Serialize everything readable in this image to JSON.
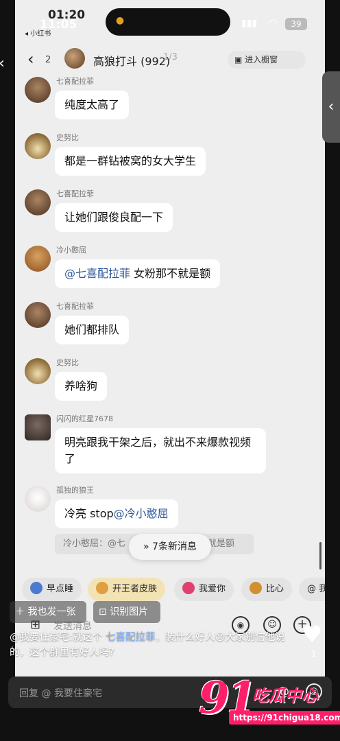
{
  "status": {
    "time_back": "01:20",
    "time_front": "11:05",
    "app_tag": "◂ 小红书",
    "battery": "39"
  },
  "chat": {
    "back_count": "2",
    "group_title": "高狼打斗 (992)",
    "counter": "1/3",
    "enter_label": "进入橱窗"
  },
  "messages": [
    {
      "sender": "七喜配拉菲",
      "text": "纯度太高了"
    },
    {
      "sender": "史努比",
      "text": "都是一群钻被窝的女大学生"
    },
    {
      "sender": "七喜配拉菲",
      "text": "让她们跟俊良配一下"
    },
    {
      "sender": "冷小憨屈",
      "mention": "@七喜配拉菲",
      "text": " 女粉那不就是额"
    },
    {
      "sender": "七喜配拉菲",
      "text": "她们都排队"
    },
    {
      "sender": "史努比",
      "text": "养啥狗"
    },
    {
      "sender": "闪闪的红星7678",
      "text": "明亮跟我干架之后，就出不来爆款视频了"
    },
    {
      "sender": "孤独的狼王",
      "text": "冷亮 stop",
      "mention": "@冷小憨屈"
    }
  ],
  "quote": {
    "left": "冷小憨屈：@七",
    "right": "不就是额"
  },
  "new_messages": "7条新消息",
  "chips": [
    {
      "label": "早点睡",
      "color": "#4a7bd0"
    },
    {
      "label": "开王者皮肤",
      "color": "#e0a040"
    },
    {
      "label": "我爱你",
      "color": "#e04070"
    },
    {
      "label": "比心",
      "color": "#d09030"
    },
    {
      "label": "@ 我",
      "color": "#3070c0"
    }
  ],
  "input": {
    "placeholder": "发送消息"
  },
  "overlay": {
    "post_label": "我也发一张",
    "ocr_label": "识别图片",
    "caption_prefix": "@我要住豪宅:就这个 ",
    "caption_link": "七喜配拉菲",
    "caption_suffix": "，装什么好人😓大家别信他说的，这个群里有好人吗?",
    "like_count": "1",
    "reply_placeholder": "回复 @ 我要住豪宅"
  },
  "watermark": {
    "big": "91",
    "text": "吃瓜中心",
    "url": "https://91chigua18.com"
  },
  "icons": [
    "back-arrow-icon",
    "store-icon",
    "grid-icon",
    "voice-icon",
    "emoji-icon",
    "plus-icon",
    "heart-icon",
    "at-icon",
    "image-scan-icon",
    "plus-post-icon"
  ]
}
